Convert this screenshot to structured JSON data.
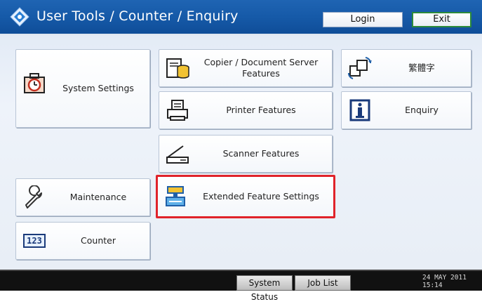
{
  "header": {
    "title": "User Tools / Counter / Enquiry",
    "login_label": "Login",
    "exit_label": "Exit"
  },
  "left_tiles": {
    "system_settings": "System Settings",
    "maintenance": "Maintenance",
    "counter": "Counter",
    "counter_icon_text": "123"
  },
  "middle_tiles": {
    "copier": "Copier / Document Server Features",
    "printer": "Printer Features",
    "scanner": "Scanner Features",
    "extended": "Extended Feature Settings"
  },
  "right_tiles": {
    "language": "繁體字",
    "enquiry": "Enquiry"
  },
  "footer": {
    "system_status": "System Status",
    "job_list": "Job List",
    "date": "24 MAY  2011",
    "time": "15:14"
  },
  "colors": {
    "header_blue": "#165aa8",
    "highlight_red": "#e0232a",
    "exit_green": "#2b8a3a"
  },
  "icons": {
    "system_settings": "alarm-clock-toolbox-icon",
    "maintenance": "wrench-icon",
    "counter": "counter-123-icon",
    "copier": "copier-document-server-icon",
    "printer": "printer-icon",
    "scanner": "scanner-icon",
    "extended": "extended-features-icon",
    "language": "language-switch-icon",
    "enquiry": "info-icon"
  }
}
